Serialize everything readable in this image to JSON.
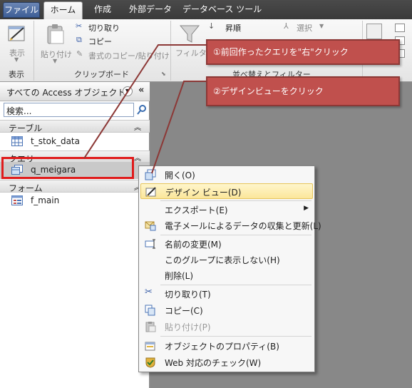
{
  "ribbon_tabs": [
    "ファイル",
    "ホーム",
    "作成",
    "外部データ",
    "データベース ツール"
  ],
  "ribbon": {
    "view_label": "表示",
    "view_group": "表示",
    "paste_label": "貼り付け",
    "cut_label": "切り取り",
    "copy_label": "コピー",
    "format_painter_label": "書式のコピー/貼り付け",
    "clipboard_group": "クリップボード",
    "filter_label": "フィルター",
    "ascending_label": "昇順",
    "select_label": "選択",
    "sort_group": "並べ替えとフィルター"
  },
  "nav": {
    "title": "すべての Access オブジェクト",
    "search_placeholder": "検索...",
    "sections": [
      {
        "label": "テーブル",
        "items": [
          "t_stok_data"
        ]
      },
      {
        "label": "クエリ",
        "items": [
          "q_meigara"
        ]
      },
      {
        "label": "フォーム",
        "items": [
          "f_main"
        ]
      }
    ]
  },
  "context_menu": [
    "開く(O)",
    "デザイン ビュー(D)",
    "エクスポート(E)",
    "電子メールによるデータの収集と更新(L)",
    "名前の変更(M)",
    "このグループに表示しない(H)",
    "削除(L)",
    "切り取り(T)",
    "コピー(C)",
    "貼り付け(P)",
    "オブジェクトのプロパティ(B)",
    "Web 対応のチェック(W)"
  ],
  "callouts": {
    "step1": "①前回作ったクエリを\"右\"クリック",
    "step2": "②デザインビューをクリック"
  },
  "colors": {
    "callout": "#c0504d",
    "highlight_border": "#e01b1b",
    "menu_highlight": "#fbe69a"
  }
}
